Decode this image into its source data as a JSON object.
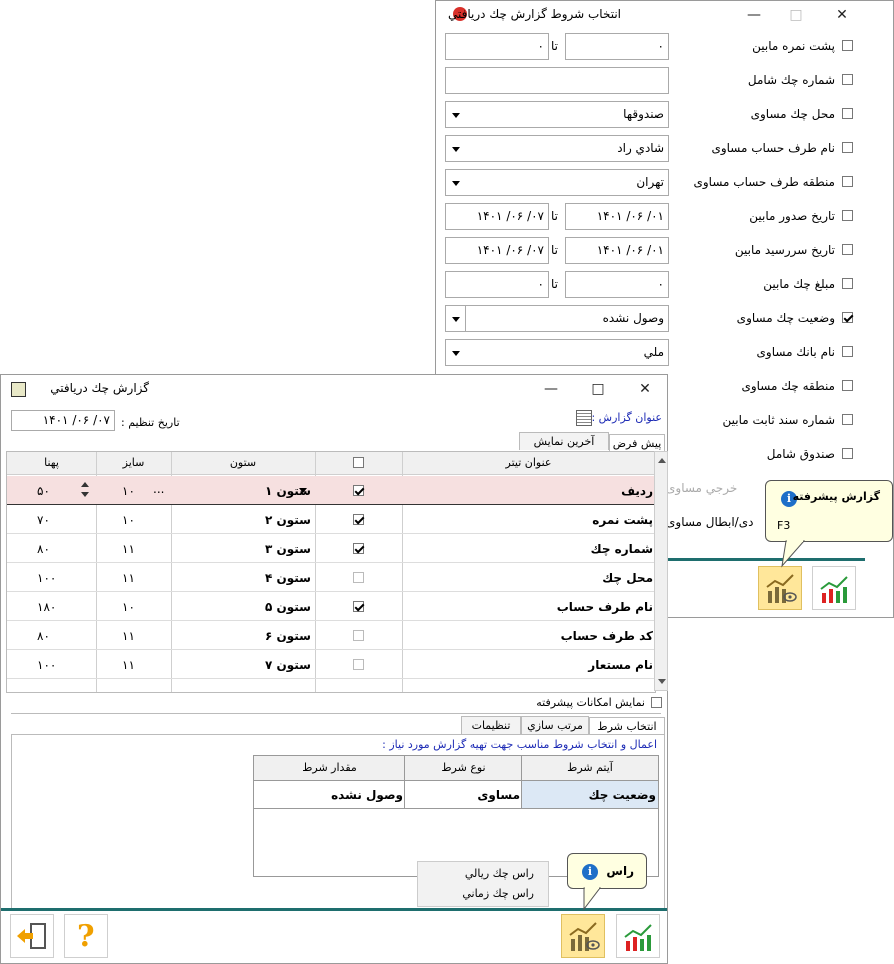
{
  "cond_window": {
    "title": "انتخاب شروط گزارش چك دريافتي",
    "conditions": [
      {
        "label": "پشت نمره مابين",
        "checked": false
      },
      {
        "label": "شماره چك شامل",
        "checked": false
      },
      {
        "label": "محل چك مساوی",
        "checked": false
      },
      {
        "label": "نام طرف حساب مساوی",
        "checked": false
      },
      {
        "label": "منطقه طرف حساب مساوی",
        "checked": false
      },
      {
        "label": "تاريخ صدور مابين",
        "checked": false
      },
      {
        "label": "تاريخ سررسيد مابين",
        "checked": false
      },
      {
        "label": "مبلغ چك مابين",
        "checked": false
      },
      {
        "label": "وضعيت چك مساوی",
        "checked": true
      },
      {
        "label": "نام بانك مساوی",
        "checked": false
      },
      {
        "label": "منطقه چك مساوی",
        "checked": false
      },
      {
        "label": "شماره سند ثابت مابين",
        "checked": false
      },
      {
        "label": "صندوق شامل",
        "checked": false
      },
      {
        "label": "خرجي مساوی",
        "checked": false
      },
      {
        "label": "دی/ابطال مساوی",
        "checked": false
      }
    ],
    "to_label": "تا",
    "serial_from": "۰",
    "serial_to": "۰",
    "check_no": "",
    "place_value": "صندوقها",
    "party_value": "شادي راد",
    "region_value": "تهران",
    "issue_from": "۰۱/ ۰۶/ ۱۴۰۱",
    "issue_to": "۰۷/ ۰۶/ ۱۴۰۱",
    "due_from": "۰۱/ ۰۶/ ۱۴۰۱",
    "due_to": "۰۷/ ۰۶/ ۱۴۰۱",
    "amount_from": "۰",
    "amount_to": "۰",
    "status_value": "وصول نشده",
    "bank_value": "ملي",
    "tooltip_title": "گزارش پيشرفته",
    "tooltip_key": "F3"
  },
  "report_window": {
    "title": "گزارش چك دريافتي",
    "date_label": "تاريخ تنظيم :",
    "date_value": "۰۷/ ۰۶/ ۱۴۰۱",
    "report_title_label": "عنوان گزارش :",
    "tabs_top": [
      "پيش فرض",
      "آخرين نمايش"
    ],
    "columns": [
      "عنوان تيتر",
      "",
      "ستون",
      "سايز",
      "پهنا"
    ],
    "rows": [
      {
        "title": "رديف",
        "checked": true,
        "col": "ستون ۱",
        "size": "۱۰",
        "width": "۵۰"
      },
      {
        "title": "پشت نمره",
        "checked": true,
        "col": "ستون ۲",
        "size": "۱۰",
        "width": "۷۰"
      },
      {
        "title": "شماره چك",
        "checked": true,
        "col": "ستون ۳",
        "size": "۱۱",
        "width": "۸۰"
      },
      {
        "title": "محل چك",
        "checked": false,
        "col": "ستون ۴",
        "size": "۱۱",
        "width": "۱۰۰"
      },
      {
        "title": "نام طرف حساب",
        "checked": true,
        "col": "ستون ۵",
        "size": "۱۰",
        "width": "۱۸۰"
      },
      {
        "title": "كد طرف حساب",
        "checked": false,
        "col": "ستون ۶",
        "size": "۱۱",
        "width": "۸۰"
      },
      {
        "title": "نام مستعار",
        "checked": false,
        "col": "ستون ۷",
        "size": "۱۱",
        "width": "۱۰۰"
      }
    ],
    "ellipsis": "...",
    "advanced_label": "نمايش امكانات پيشرفته",
    "tabs_bottom": [
      "انتخاب شرط",
      "مرتب سازي",
      "تنظيمات"
    ],
    "hint": "اعمال و انتخاب شروط مناسب جهت تهيه گزارش  مورد نياز :",
    "cond_columns": [
      "آيتم شرط",
      "نوع شرط",
      "مقدار شرط"
    ],
    "cond_row": {
      "item": "وضعيت چك",
      "type": "مساوی",
      "value": "وصول نشده"
    },
    "menu_items": [
      "راس چك ريالي",
      "راس چك زماني"
    ],
    "tooltip_title": "راس"
  },
  "colors": {
    "accent": "#1e6e6e",
    "highlight_row": "#f6e0e0",
    "selected_cell": "#dce8f5",
    "tooltip_bg": "#ffffe1"
  }
}
